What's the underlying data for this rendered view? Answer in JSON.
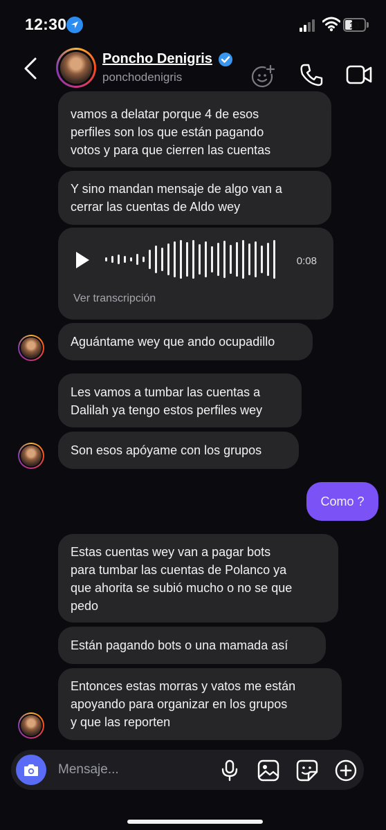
{
  "status": {
    "time": "12:30",
    "battery": "13"
  },
  "header": {
    "name": "Poncho Denigris",
    "handle": "ponchodenigris"
  },
  "messages": {
    "m1": "vamos a delatar porque 4 de esos\nperfiles son los que están pagando\nvotos y para que cierren las cuentas",
    "m2": "Y sino mandan mensaje de algo van a\ncerrar las cuentas de Aldo wey",
    "voice": {
      "duration": "0:08",
      "transcript": "Ver transcripción"
    },
    "m3": "Aguántame wey que ando ocupadillo",
    "m4": "Les vamos a tumbar las cuentas a\nDalilah ya tengo estos perfiles wey",
    "m5": "Son esos apóyame con los grupos",
    "out1": "Como ?",
    "m6": "Estas cuentas wey van a pagar bots\npara tumbar las cuentas de Polanco ya\nque ahorita se subió mucho o no se que\npedo",
    "m7": "Están pagando bots o una mamada así",
    "m8": "Entonces estas morras y vatos me están\napoyando para organizar en los grupos\ny que las reporten"
  },
  "composer": {
    "placeholder": "Mensaje..."
  },
  "colors": {
    "outgoing": "#7b52f5",
    "incoming": "#262629",
    "camera": "#5a6cf5",
    "verified": "#3897f0"
  }
}
